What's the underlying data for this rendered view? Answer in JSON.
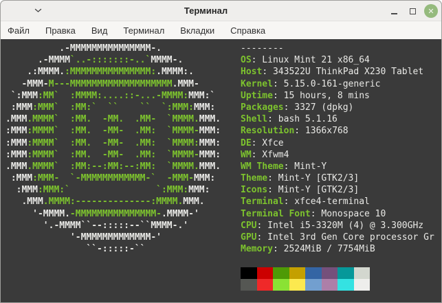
{
  "window": {
    "title": "Терминал",
    "controls": {
      "window_menu_icon": "chevron-down",
      "minimize_icon": "minimize-bar",
      "maximize_icon": "square-outline",
      "close_icon": "x-cross",
      "close_glyph": "✕"
    }
  },
  "menu": {
    "items": [
      {
        "name": "file",
        "label": "Файл"
      },
      {
        "name": "edit",
        "label": "Правка"
      },
      {
        "name": "view",
        "label": "Вид"
      },
      {
        "name": "terminal",
        "label": "Терминал"
      },
      {
        "name": "tabs",
        "label": "Вкладки"
      },
      {
        "name": "help",
        "label": "Справка"
      }
    ]
  },
  "terminal": {
    "ascii_art": {
      "colors": {
        "w": "white",
        "g": "green"
      },
      "lines": [
        [
          [
            "w",
            "          .-MMMMMMMMMMMMMMM-."
          ]
        ],
        [
          [
            "w",
            "      .-MMMM"
          ],
          [
            "g",
            "`..-:::::::-..`"
          ],
          [
            "w",
            "MMMM-."
          ]
        ],
        [
          [
            "w",
            "    .:MMMM."
          ],
          [
            "g",
            ":MMMMMMMMMMMMMMM:"
          ],
          [
            "w",
            ".MMMM:."
          ]
        ],
        [
          [
            "w",
            "   -MMM-"
          ],
          [
            "g",
            "M---MMMMMMMMMMMMMMMMMMM"
          ],
          [
            "w",
            ".MMM-"
          ]
        ],
        [
          [
            "w",
            " `:MMM"
          ],
          [
            "g",
            ":MM`  :MMMM:....::-...-MMMM:"
          ],
          [
            "w",
            "MMM:`"
          ]
        ],
        [
          [
            "w",
            " :MMM"
          ],
          [
            "g",
            ":MMM`  :MM:`  ``    ``  `:MMM:"
          ],
          [
            "w",
            "MMM:"
          ]
        ],
        [
          [
            "w",
            ".MMM"
          ],
          [
            "g",
            ".MMMM`  :MM.  -MM.  .MM-  `MMMM."
          ],
          [
            "w",
            "MMM."
          ]
        ],
        [
          [
            "w",
            ":MMM"
          ],
          [
            "g",
            ":MMMM`  :MM.  -MM-  .MM:  `MMMM-"
          ],
          [
            "w",
            "MMM:"
          ]
        ],
        [
          [
            "w",
            ":MMM"
          ],
          [
            "g",
            ":MMMM`  :MM.  -MM-  .MM:  `MMMM:"
          ],
          [
            "w",
            "MMM:"
          ]
        ],
        [
          [
            "w",
            ":MMM"
          ],
          [
            "g",
            ":MMMM`  :MM.  -MM-  .MM:  `MMMM-"
          ],
          [
            "w",
            "MMM:"
          ]
        ],
        [
          [
            "w",
            ".MMM"
          ],
          [
            "g",
            ".MMMM`  :MM:--:MM:--:MM:  `MMMM."
          ],
          [
            "w",
            "MMM."
          ]
        ],
        [
          [
            "w",
            " :MMM"
          ],
          [
            "g",
            ":MMM-  `-MMMMMMMMMMMM-`  -MMM-"
          ],
          [
            "w",
            "MMM:"
          ]
        ],
        [
          [
            "w",
            "  :MMM"
          ],
          [
            "g",
            ":MMM:`                `:MMM:"
          ],
          [
            "w",
            "MMM:"
          ]
        ],
        [
          [
            "w",
            "   .MMM"
          ],
          [
            "g",
            ".MMMM:--------------:MMMM."
          ],
          [
            "w",
            "MMM."
          ]
        ],
        [
          [
            "w",
            "     '-MMMM."
          ],
          [
            "g",
            "-MMMMMMMMMMMMMMM-"
          ],
          [
            "w",
            ".MMMM-'"
          ]
        ],
        [
          [
            "w",
            "       '.-MMMM``--:::::--``MMMM-.'"
          ]
        ],
        [
          [
            "w",
            "            '-MMMMMMMMMMMMM-'"
          ]
        ],
        [
          [
            "w",
            "               ``-:::::-``"
          ]
        ]
      ]
    },
    "info": {
      "divider": "--------",
      "entries": [
        {
          "key": "os",
          "label": "OS",
          "value": "Linux Mint 21 x86_64"
        },
        {
          "key": "host",
          "label": "Host",
          "value": "343522U ThinkPad X230 Tablet"
        },
        {
          "key": "kernel",
          "label": "Kernel",
          "value": "5.15.0-161-generic"
        },
        {
          "key": "uptime",
          "label": "Uptime",
          "value": "15 hours, 8 mins"
        },
        {
          "key": "packages",
          "label": "Packages",
          "value": "3327 (dpkg)"
        },
        {
          "key": "shell",
          "label": "Shell",
          "value": "bash 5.1.16"
        },
        {
          "key": "resolution",
          "label": "Resolution",
          "value": "1366x768"
        },
        {
          "key": "de",
          "label": "DE",
          "value": "Xfce"
        },
        {
          "key": "wm",
          "label": "WM",
          "value": "Xfwm4"
        },
        {
          "key": "wm-theme",
          "label": "WM Theme",
          "value": "Mint-Y"
        },
        {
          "key": "theme",
          "label": "Theme",
          "value": "Mint-Y [GTK2/3]"
        },
        {
          "key": "icons",
          "label": "Icons",
          "value": "Mint-Y [GTK2/3]"
        },
        {
          "key": "terminal",
          "label": "Terminal",
          "value": "xfce4-terminal"
        },
        {
          "key": "terminal-font",
          "label": "Terminal Font",
          "value": "Monospace 10"
        },
        {
          "key": "cpu",
          "label": "CPU",
          "value": "Intel i5-3320M (4) @ 3.300GHz"
        },
        {
          "key": "gpu",
          "label": "GPU",
          "value": "Intel 3rd Gen Core processor Gr"
        },
        {
          "key": "memory",
          "label": "Memory",
          "value": "2524MiB / 7754MiB"
        }
      ]
    },
    "palette": {
      "row_normal": [
        "#000000",
        "#cc0000",
        "#4e9a06",
        "#c4a000",
        "#3465a4",
        "#75507b",
        "#06989a",
        "#d3d7cf"
      ],
      "row_bright": [
        "#555753",
        "#ef2929",
        "#8ae234",
        "#fce94f",
        "#729fcf",
        "#ad7fa8",
        "#34e2e2",
        "#eeeeec"
      ]
    }
  },
  "colors": {
    "terminal_bg": "#3a3a3a",
    "text_white": "#e9e9e6",
    "text_green": "#7dc32e",
    "titlebar_bg": "#efeeec",
    "menubar_bg": "#f7f6f4",
    "close_button": "#95ba7d",
    "window_border": "#9f9f9c"
  }
}
